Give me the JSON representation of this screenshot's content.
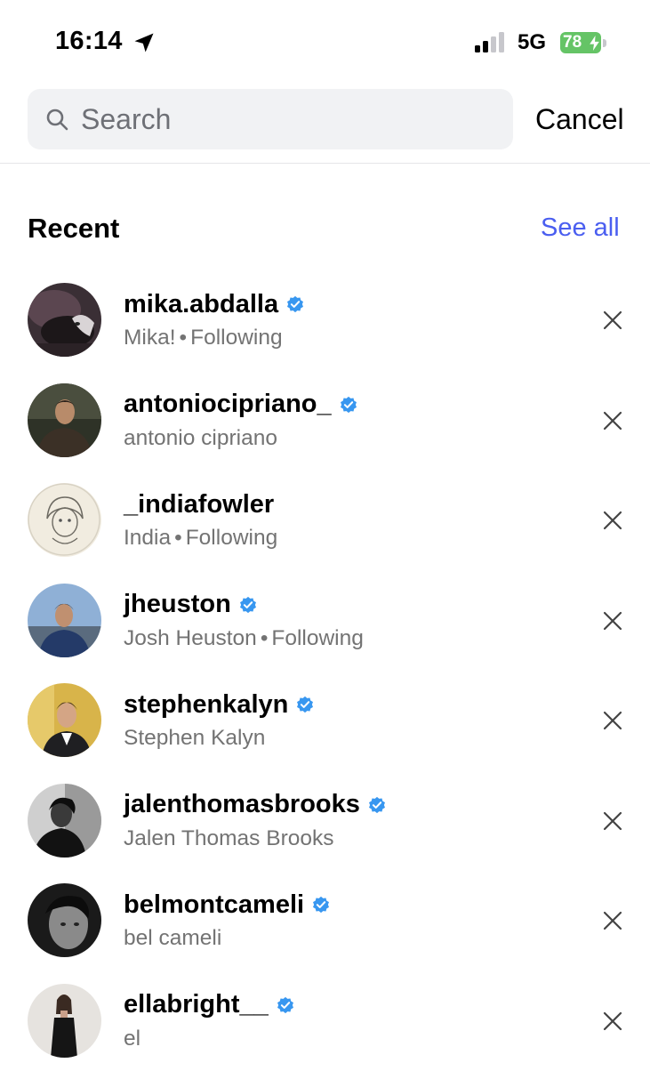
{
  "status_bar": {
    "time": "16:14",
    "network": "5G",
    "battery": "78",
    "battery_color": "#65c466"
  },
  "search": {
    "placeholder": "Search",
    "value": "",
    "cancel_label": "Cancel"
  },
  "recent": {
    "title": "Recent",
    "see_all_label": "See all",
    "accent_color": "#4a5ef0",
    "items": [
      {
        "username": "mika.abdalla",
        "verified": true,
        "name": "Mika!",
        "following_label": "Following",
        "avatar": "cat-photo"
      },
      {
        "username": "antoniocipriano_",
        "verified": true,
        "name": "antonio cipriano",
        "following_label": "",
        "avatar": "man-hoodie"
      },
      {
        "username": "_indiafowler",
        "verified": false,
        "name": "India",
        "following_label": "Following",
        "avatar": "anime-sketch"
      },
      {
        "username": "jheuston",
        "verified": true,
        "name": "Josh Heuston",
        "following_label": "Following",
        "avatar": "man-outdoors"
      },
      {
        "username": "stephenkalyn",
        "verified": true,
        "name": "Stephen Kalyn",
        "following_label": "",
        "avatar": "man-suit-gold"
      },
      {
        "username": "jalenthomasbrooks",
        "verified": true,
        "name": "Jalen Thomas Brooks",
        "following_label": "",
        "avatar": "man-bw-portrait"
      },
      {
        "username": "belmontcameli",
        "verified": true,
        "name": "bel cameli",
        "following_label": "",
        "avatar": "man-bw-closeup"
      },
      {
        "username": "ellabright__",
        "verified": true,
        "name": "el",
        "following_label": "",
        "avatar": "woman-black-dress"
      }
    ]
  },
  "icons": {
    "location": "location-arrow-icon",
    "search": "search-icon",
    "verified": "verified-badge-icon",
    "remove": "close-icon"
  }
}
